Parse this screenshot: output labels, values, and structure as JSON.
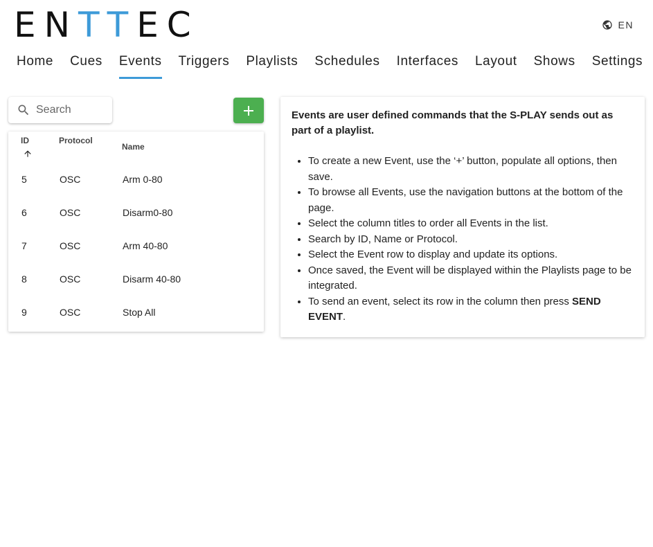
{
  "header": {
    "logo": {
      "part1": "EN",
      "part2": "TT",
      "part3": "EC"
    },
    "language": {
      "icon": "globe-icon",
      "label": "EN"
    }
  },
  "nav": {
    "items": [
      {
        "label": "Home"
      },
      {
        "label": "Cues"
      },
      {
        "label": "Events",
        "active": true
      },
      {
        "label": "Triggers"
      },
      {
        "label": "Playlists"
      },
      {
        "label": "Schedules"
      },
      {
        "label": "Interfaces"
      },
      {
        "label": "Layout"
      },
      {
        "label": "Shows"
      },
      {
        "label": "Settings"
      }
    ]
  },
  "search": {
    "placeholder": "Search",
    "icon": "search-icon"
  },
  "add_button": {
    "icon": "plus-icon",
    "color": "#4caf50"
  },
  "table": {
    "columns": {
      "id": "ID",
      "protocol": "Protocol",
      "name": "Name"
    },
    "sort": {
      "column": "ID",
      "direction": "ascending",
      "icon": "arrow-up-icon"
    },
    "rows": [
      {
        "id": "5",
        "protocol": "OSC",
        "name": "Arm 0-80"
      },
      {
        "id": "6",
        "protocol": "OSC",
        "name": "Disarm0-80"
      },
      {
        "id": "7",
        "protocol": "OSC",
        "name": "Arm 40-80"
      },
      {
        "id": "8",
        "protocol": "OSC",
        "name": "Disarm 40-80"
      },
      {
        "id": "9",
        "protocol": "OSC",
        "name": "Stop All"
      }
    ]
  },
  "info": {
    "title": "Events are user defined commands that the S-PLAY sends out as part of a playlist.",
    "bullets": [
      "To create a new Event, use the ‘+’ button, populate all options, then save.",
      "To browse all Events, use the navigation buttons at the bottom of the page.",
      "Select the column titles to order all Events in the list.",
      "Search by ID, Name or Protocol.",
      "Select the Event row to display and update its options.",
      "Once saved, the Event will be displayed within the Playlists page to be integrated."
    ],
    "last_bullet_prefix": "To send an event, select its row in the column then press ",
    "last_bullet_bold": "SEND EVENT",
    "last_bullet_suffix": "."
  },
  "colors": {
    "accent": "#3d9ad8",
    "add_button": "#4caf50"
  }
}
